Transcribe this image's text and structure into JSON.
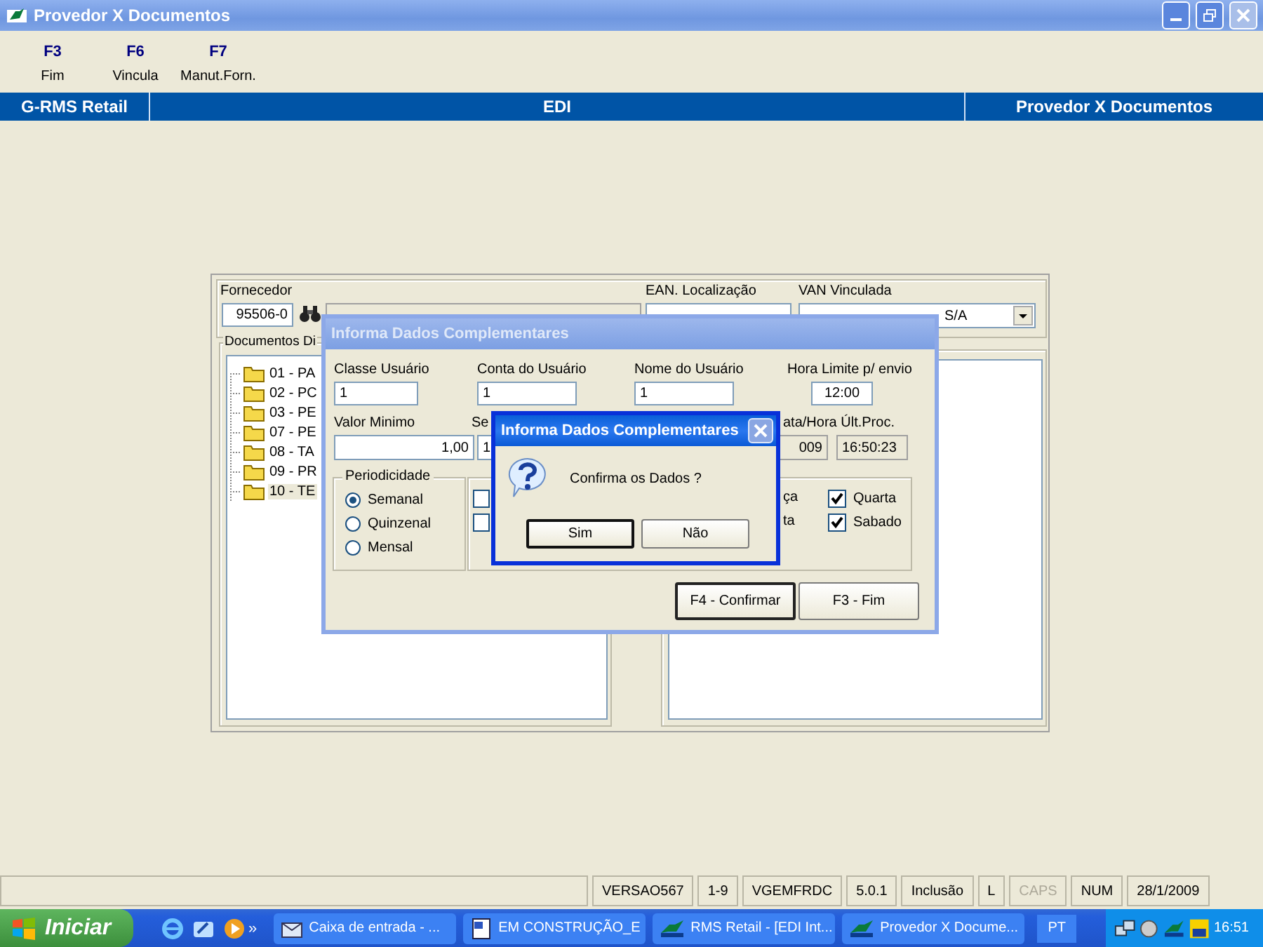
{
  "window": {
    "title": "Provedor X Documentos"
  },
  "toolbar": [
    {
      "key": "F3",
      "label": "Fim"
    },
    {
      "key": "F6",
      "label": "Vincula"
    },
    {
      "key": "F7",
      "label": "Manut.Forn."
    }
  ],
  "header": [
    "G-RMS Retail",
    "EDI",
    "Provedor X Documentos"
  ],
  "supplier_panel": {
    "fornecedor_label": "Fornecedor",
    "fornecedor_code": "95506-0",
    "ean_label": "EAN. Localização",
    "van_label": "VAN Vinculada",
    "van_value": "S/A",
    "documents_legend": "Documentos Di",
    "documents": [
      {
        "label": "01 - PA",
        "selected": false
      },
      {
        "label": "02 - PC",
        "selected": false
      },
      {
        "label": "03 - PE",
        "selected": false
      },
      {
        "label": "07 - PE",
        "selected": false
      },
      {
        "label": "08 - TA",
        "selected": false
      },
      {
        "label": "09 - PR",
        "selected": false
      },
      {
        "label": "10 - TE",
        "selected": true
      }
    ]
  },
  "complement_dialog": {
    "title": "Informa Dados Complementares",
    "fields": [
      {
        "label": "Classe Usuário",
        "value": "1"
      },
      {
        "label": "Conta do Usuário",
        "value": "1"
      },
      {
        "label": "Nome do Usuário",
        "value": "1"
      },
      {
        "label": "Hora Limite p/ envio",
        "value": "12:00"
      }
    ],
    "valor_minimo": {
      "label": "Valor Minimo",
      "value": "1,00"
    },
    "second_field": {
      "label": "Se",
      "value": "1"
    },
    "last_process": {
      "label": "ata/Hora Últ.Proc.",
      "date": "009",
      "time": "16:50:23"
    },
    "periodicidade": {
      "legend": "Periodicidade",
      "options": [
        {
          "label": "Semanal",
          "selected": true
        },
        {
          "label": "Quinzenal",
          "selected": false
        },
        {
          "label": "Mensal",
          "selected": false
        }
      ]
    },
    "day_boxes": [
      {
        "checked": false
      },
      {
        "checked": false
      }
    ],
    "day_fragments": [
      "ça",
      "ta"
    ],
    "days": [
      {
        "label": "Quarta",
        "checked": true
      },
      {
        "label": "Sabado",
        "checked": true
      }
    ],
    "buttons": [
      {
        "label": "F4 - Confirmar",
        "default": true
      },
      {
        "label": "F3 - Fim",
        "default": false
      }
    ]
  },
  "confirm_dialog": {
    "title": "Informa Dados Complementares",
    "message": "Confirma os Dados ?",
    "buttons": [
      {
        "label": "Sim",
        "focused": true
      },
      {
        "label": "Não",
        "focused": false
      }
    ]
  },
  "status_bar": [
    {
      "text": "VERSAO567",
      "on": true
    },
    {
      "text": "1-9",
      "on": true
    },
    {
      "text": "VGEMFRDC",
      "on": true
    },
    {
      "text": "5.0.1",
      "on": true
    },
    {
      "text": "Inclusão",
      "on": true
    },
    {
      "text": "L",
      "on": true
    },
    {
      "text": "CAPS",
      "on": false
    },
    {
      "text": "NUM",
      "on": true
    },
    {
      "text": "28/1/2009",
      "on": true
    }
  ],
  "taskbar": {
    "start": "Iniciar",
    "more": "»",
    "tasks": [
      {
        "label": "Caixa de entrada - ...",
        "kind": "mail"
      },
      {
        "label": "EM CONSTRUÇÃO_E",
        "kind": "doc"
      },
      {
        "label": "RMS Retail - [EDI Int...",
        "kind": "app"
      },
      {
        "label": "Provedor X Docume...",
        "kind": "app"
      }
    ],
    "language": "PT",
    "clock": "16:51"
  }
}
